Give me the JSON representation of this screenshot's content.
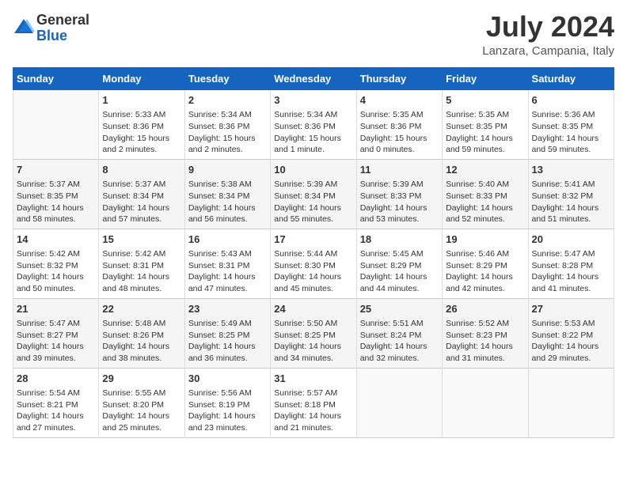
{
  "logo": {
    "general": "General",
    "blue": "Blue"
  },
  "title": "July 2024",
  "location": "Lanzara, Campania, Italy",
  "days_of_week": [
    "Sunday",
    "Monday",
    "Tuesday",
    "Wednesday",
    "Thursday",
    "Friday",
    "Saturday"
  ],
  "weeks": [
    [
      {
        "day": "",
        "info": ""
      },
      {
        "day": "1",
        "info": "Sunrise: 5:33 AM\nSunset: 8:36 PM\nDaylight: 15 hours\nand 2 minutes."
      },
      {
        "day": "2",
        "info": "Sunrise: 5:34 AM\nSunset: 8:36 PM\nDaylight: 15 hours\nand 2 minutes."
      },
      {
        "day": "3",
        "info": "Sunrise: 5:34 AM\nSunset: 8:36 PM\nDaylight: 15 hours\nand 1 minute."
      },
      {
        "day": "4",
        "info": "Sunrise: 5:35 AM\nSunset: 8:36 PM\nDaylight: 15 hours\nand 0 minutes."
      },
      {
        "day": "5",
        "info": "Sunrise: 5:35 AM\nSunset: 8:35 PM\nDaylight: 14 hours\nand 59 minutes."
      },
      {
        "day": "6",
        "info": "Sunrise: 5:36 AM\nSunset: 8:35 PM\nDaylight: 14 hours\nand 59 minutes."
      }
    ],
    [
      {
        "day": "7",
        "info": "Sunrise: 5:37 AM\nSunset: 8:35 PM\nDaylight: 14 hours\nand 58 minutes."
      },
      {
        "day": "8",
        "info": "Sunrise: 5:37 AM\nSunset: 8:34 PM\nDaylight: 14 hours\nand 57 minutes."
      },
      {
        "day": "9",
        "info": "Sunrise: 5:38 AM\nSunset: 8:34 PM\nDaylight: 14 hours\nand 56 minutes."
      },
      {
        "day": "10",
        "info": "Sunrise: 5:39 AM\nSunset: 8:34 PM\nDaylight: 14 hours\nand 55 minutes."
      },
      {
        "day": "11",
        "info": "Sunrise: 5:39 AM\nSunset: 8:33 PM\nDaylight: 14 hours\nand 53 minutes."
      },
      {
        "day": "12",
        "info": "Sunrise: 5:40 AM\nSunset: 8:33 PM\nDaylight: 14 hours\nand 52 minutes."
      },
      {
        "day": "13",
        "info": "Sunrise: 5:41 AM\nSunset: 8:32 PM\nDaylight: 14 hours\nand 51 minutes."
      }
    ],
    [
      {
        "day": "14",
        "info": "Sunrise: 5:42 AM\nSunset: 8:32 PM\nDaylight: 14 hours\nand 50 minutes."
      },
      {
        "day": "15",
        "info": "Sunrise: 5:42 AM\nSunset: 8:31 PM\nDaylight: 14 hours\nand 48 minutes."
      },
      {
        "day": "16",
        "info": "Sunrise: 5:43 AM\nSunset: 8:31 PM\nDaylight: 14 hours\nand 47 minutes."
      },
      {
        "day": "17",
        "info": "Sunrise: 5:44 AM\nSunset: 8:30 PM\nDaylight: 14 hours\nand 45 minutes."
      },
      {
        "day": "18",
        "info": "Sunrise: 5:45 AM\nSunset: 8:29 PM\nDaylight: 14 hours\nand 44 minutes."
      },
      {
        "day": "19",
        "info": "Sunrise: 5:46 AM\nSunset: 8:29 PM\nDaylight: 14 hours\nand 42 minutes."
      },
      {
        "day": "20",
        "info": "Sunrise: 5:47 AM\nSunset: 8:28 PM\nDaylight: 14 hours\nand 41 minutes."
      }
    ],
    [
      {
        "day": "21",
        "info": "Sunrise: 5:47 AM\nSunset: 8:27 PM\nDaylight: 14 hours\nand 39 minutes."
      },
      {
        "day": "22",
        "info": "Sunrise: 5:48 AM\nSunset: 8:26 PM\nDaylight: 14 hours\nand 38 minutes."
      },
      {
        "day": "23",
        "info": "Sunrise: 5:49 AM\nSunset: 8:25 PM\nDaylight: 14 hours\nand 36 minutes."
      },
      {
        "day": "24",
        "info": "Sunrise: 5:50 AM\nSunset: 8:25 PM\nDaylight: 14 hours\nand 34 minutes."
      },
      {
        "day": "25",
        "info": "Sunrise: 5:51 AM\nSunset: 8:24 PM\nDaylight: 14 hours\nand 32 minutes."
      },
      {
        "day": "26",
        "info": "Sunrise: 5:52 AM\nSunset: 8:23 PM\nDaylight: 14 hours\nand 31 minutes."
      },
      {
        "day": "27",
        "info": "Sunrise: 5:53 AM\nSunset: 8:22 PM\nDaylight: 14 hours\nand 29 minutes."
      }
    ],
    [
      {
        "day": "28",
        "info": "Sunrise: 5:54 AM\nSunset: 8:21 PM\nDaylight: 14 hours\nand 27 minutes."
      },
      {
        "day": "29",
        "info": "Sunrise: 5:55 AM\nSunset: 8:20 PM\nDaylight: 14 hours\nand 25 minutes."
      },
      {
        "day": "30",
        "info": "Sunrise: 5:56 AM\nSunset: 8:19 PM\nDaylight: 14 hours\nand 23 minutes."
      },
      {
        "day": "31",
        "info": "Sunrise: 5:57 AM\nSunset: 8:18 PM\nDaylight: 14 hours\nand 21 minutes."
      },
      {
        "day": "",
        "info": ""
      },
      {
        "day": "",
        "info": ""
      },
      {
        "day": "",
        "info": ""
      }
    ]
  ]
}
